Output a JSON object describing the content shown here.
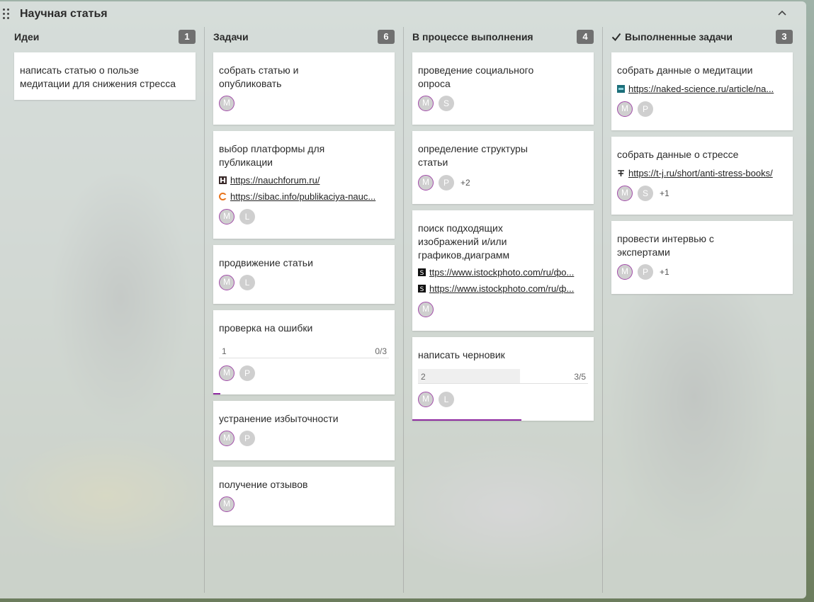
{
  "board": {
    "title": "Научная статья"
  },
  "columns": [
    {
      "title": "Идеи",
      "count": "1",
      "cards": [
        {
          "title": "написать статью о пользе медитации для снижения стресса"
        }
      ]
    },
    {
      "title": "Задачи",
      "count": "6",
      "cards": [
        {
          "title": "собрать статью и опубликовать",
          "avatars": [
            "M"
          ]
        },
        {
          "title": "выбор платформы для публикации",
          "links": [
            "https://nauchforum.ru/",
            "https://sibac.info/publikaciya-nauc..."
          ],
          "avatars": [
            "M",
            "L"
          ]
        },
        {
          "title": "продвижение статьи",
          "avatars": [
            "M",
            "L"
          ]
        },
        {
          "title": "проверка на ошибки",
          "checklist": {
            "number": "1",
            "fraction": "0/3",
            "progress": 0.0
          },
          "avatars": [
            "M",
            "P"
          ]
        },
        {
          "title": "устранение избыточности",
          "avatars": [
            "M",
            "P"
          ]
        },
        {
          "title": "получение отзывов",
          "avatars": [
            "M"
          ]
        }
      ]
    },
    {
      "title": "В процессе выполнения",
      "count": "4",
      "cards": [
        {
          "title": "проведение социального опроса",
          "avatars": [
            "M",
            "S"
          ]
        },
        {
          "title": "определение структуры статьи",
          "avatars": [
            "M",
            "P"
          ],
          "more": "+2"
        },
        {
          "title": "поиск подходящих изображений и/или графиков,диаграмм",
          "links": [
            "ttps://www.istockphoto.com/ru/фо...",
            "https://www.istockphoto.com/ru/ф..."
          ],
          "avatars": [
            "M"
          ]
        },
        {
          "title": "написать черновик",
          "checklist": {
            "number": "2",
            "fraction": "3/5",
            "progress": 0.6
          },
          "avatars": [
            "M",
            "L"
          ]
        }
      ]
    },
    {
      "title": "Выполненные задачи",
      "count": "3",
      "cards": [
        {
          "title": "собрать данные о медитации",
          "links": [
            "https://naked-science.ru/article/na..."
          ],
          "avatars": [
            "M",
            "P"
          ]
        },
        {
          "title": "собрать данные о стрессе",
          "links": [
            "https://t-j.ru/short/anti-stress-books/"
          ],
          "avatars": [
            "M",
            "S"
          ],
          "more": "+1"
        },
        {
          "title": "провести интервью с экспертами",
          "avatars": [
            "M",
            "P"
          ],
          "more": "+1"
        }
      ]
    }
  ],
  "colors": {
    "accent": "#8e2aa0",
    "count_badge": "#707070"
  },
  "icons": {
    "drag": "drag-handle-icon",
    "collapse": "chevron-up-icon",
    "done": "checkmark-icon"
  }
}
